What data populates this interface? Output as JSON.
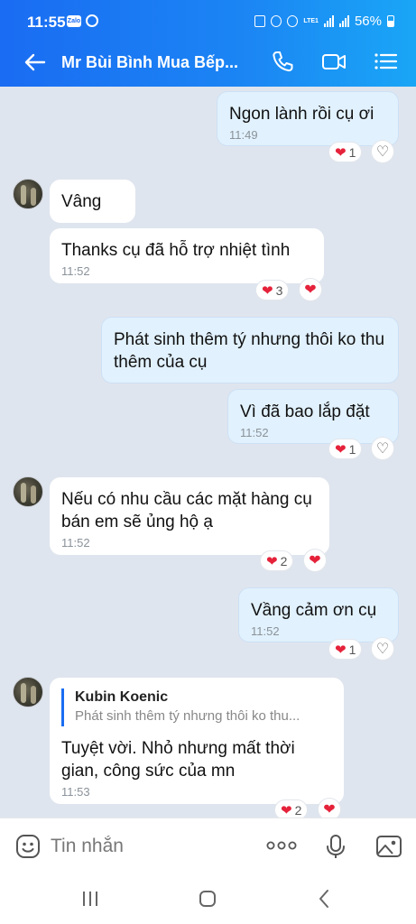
{
  "status_bar": {
    "time": "11:55",
    "zalo_badge": "Zalo",
    "lte": "LTE1",
    "battery": "56%"
  },
  "header": {
    "contact_name": "Mr Bùi Bình Mua Bếp..."
  },
  "messages": [
    {
      "text": "Ngon lành rồi cụ ơi",
      "time": "11:49",
      "reaction_count": "1"
    },
    {
      "text": "Vâng"
    },
    {
      "text": "Thanks cụ đã hỗ trợ nhiệt tình",
      "time": "11:52",
      "reaction_count": "3"
    },
    {
      "text": "Phát sinh thêm tý nhưng thôi ko thu thêm của cụ"
    },
    {
      "text": "Vì đã bao lắp đặt",
      "time": "11:52",
      "reaction_count": "1"
    },
    {
      "text": "Nếu có nhu cầu các mặt hàng cụ bán em sẽ ủng hộ ạ",
      "time": "11:52",
      "reaction_count": "2"
    },
    {
      "text": "Vầng cảm ơn cụ",
      "time": "11:52",
      "reaction_count": "1"
    },
    {
      "quote_author": "Kubin Koenic",
      "quote_text": "Phát sinh thêm tý nhưng thôi ko thu...",
      "text": "Tuyệt vời. Nhỏ nhưng mất thời gian, công sức của mn",
      "time": "11:53",
      "reaction_count": "2"
    }
  ],
  "input": {
    "placeholder": "Tin nhắn"
  },
  "colors": {
    "header_start": "#1a6cf2",
    "header_end": "#1aa6f6",
    "my_bubble": "#e1f1fd",
    "their_bubble": "#ffffff",
    "heart": "#e5223a",
    "chat_bg": "#dfe5ee"
  },
  "icons": [
    "back-arrow-icon",
    "phone-icon",
    "video-call-icon",
    "list-menu-icon",
    "heart-icon",
    "emoji-icon",
    "more-dots-icon",
    "mic-icon",
    "image-icon"
  ]
}
